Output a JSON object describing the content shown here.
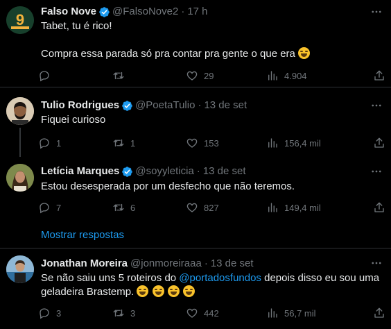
{
  "tweets": [
    {
      "name": "Falso Nove",
      "handle": "@FalsoNove2",
      "time": "17 h",
      "text": "Tabet, tu é rico!\n\nCompra essa parada só pra contar pra gente o que era",
      "replies": "",
      "retweets": "",
      "likes": "29",
      "views": "4.904",
      "avatar_text": "9",
      "avatar_sub": "FALSO NOVE"
    },
    {
      "name": "Tulio Rodrigues",
      "handle": "@PoetaTulio",
      "time": "13 de set",
      "text": "Fiquei curioso",
      "replies": "1",
      "retweets": "1",
      "likes": "153",
      "views": "156,4 mil"
    },
    {
      "name": "Letícia Marques",
      "handle": "@soyyleticia",
      "time": "13 de set",
      "text": "Estou desesperada por um desfecho que não teremos.",
      "replies": "7",
      "retweets": "6",
      "likes": "827",
      "views": "149,4 mil"
    },
    {
      "name": "Jonathan Moreira",
      "handle": "@jonmoreiraaa",
      "time": "13 de set",
      "text_before": "Se não saiu uns 5 roteiros do ",
      "mention": "@portadosfundos",
      "text_after": " depois disso eu sou uma\ngeladeira Brastemp. ",
      "replies": "3",
      "retweets": "3",
      "likes": "442",
      "views": "56,7 mil"
    }
  ],
  "show_replies": "Mostrar respostas",
  "dot": "·",
  "colors": {
    "background": "#000000",
    "text": "#e7e9ea",
    "muted": "#71767b",
    "accent": "#1d9bf0",
    "divider": "#2f3336"
  }
}
